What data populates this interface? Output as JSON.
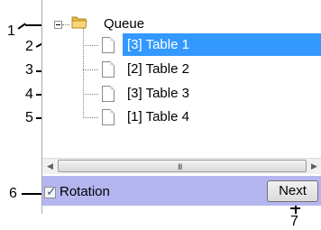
{
  "tree": {
    "root": {
      "label": "Queue",
      "icon": "folder-icon",
      "expanded": true
    },
    "items": [
      {
        "label": "[3] Table 1",
        "selected": true
      },
      {
        "label": "[2] Table 2",
        "selected": false
      },
      {
        "label": "[3] Table 3",
        "selected": false
      },
      {
        "label": "[1] Table 4",
        "selected": false
      }
    ]
  },
  "scrollbar": {
    "grip": "III"
  },
  "footer": {
    "rotation_label": "Rotation",
    "rotation_checked": true,
    "next_label": "Next"
  },
  "callouts": [
    "1",
    "2",
    "3",
    "4",
    "5",
    "6",
    "7"
  ],
  "colors": {
    "selection": "#3399ff",
    "footer_bg": "#b5b6f0"
  }
}
